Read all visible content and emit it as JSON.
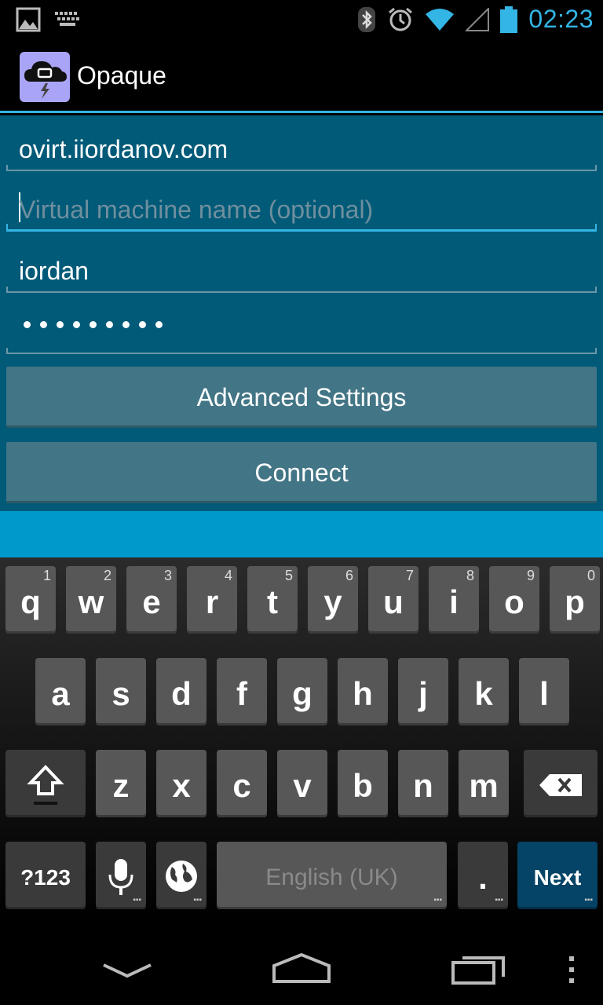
{
  "status_bar": {
    "time": "02:23",
    "left_icons": [
      "picture-icon",
      "keyboard-icon"
    ],
    "right_icons": [
      "bluetooth-icon",
      "alarm-icon",
      "wifi-icon",
      "signal-icon",
      "battery-icon"
    ],
    "accent_color": "#33b5e5"
  },
  "action_bar": {
    "title": "Opaque",
    "icon": "cloud-lightning-icon"
  },
  "form": {
    "server": {
      "value": "ovirt.iiordanov.com"
    },
    "vm_name": {
      "value": "",
      "placeholder": "Virtual machine name (optional)"
    },
    "username": {
      "value": "iordan"
    },
    "password": {
      "masked_length": 9
    },
    "advanced_settings_label": "Advanced Settings",
    "connect_label": "Connect",
    "background_color": "#005a78"
  },
  "keyboard": {
    "row1": [
      {
        "label": "q",
        "hint": "1"
      },
      {
        "label": "w",
        "hint": "2"
      },
      {
        "label": "e",
        "hint": "3"
      },
      {
        "label": "r",
        "hint": "4"
      },
      {
        "label": "t",
        "hint": "5"
      },
      {
        "label": "y",
        "hint": "6"
      },
      {
        "label": "u",
        "hint": "7"
      },
      {
        "label": "i",
        "hint": "8"
      },
      {
        "label": "o",
        "hint": "9"
      },
      {
        "label": "p",
        "hint": "0"
      }
    ],
    "row2": [
      "a",
      "s",
      "d",
      "f",
      "g",
      "h",
      "j",
      "k",
      "l"
    ],
    "row3": [
      "z",
      "x",
      "c",
      "v",
      "b",
      "n",
      "m"
    ],
    "symbols_label": "?123",
    "space_label": "English (UK)",
    "period_label": ".",
    "next_label": "Next"
  },
  "nav_bar": {
    "icons": [
      "back-icon",
      "home-icon",
      "recent-apps-icon",
      "menu-icon"
    ]
  }
}
